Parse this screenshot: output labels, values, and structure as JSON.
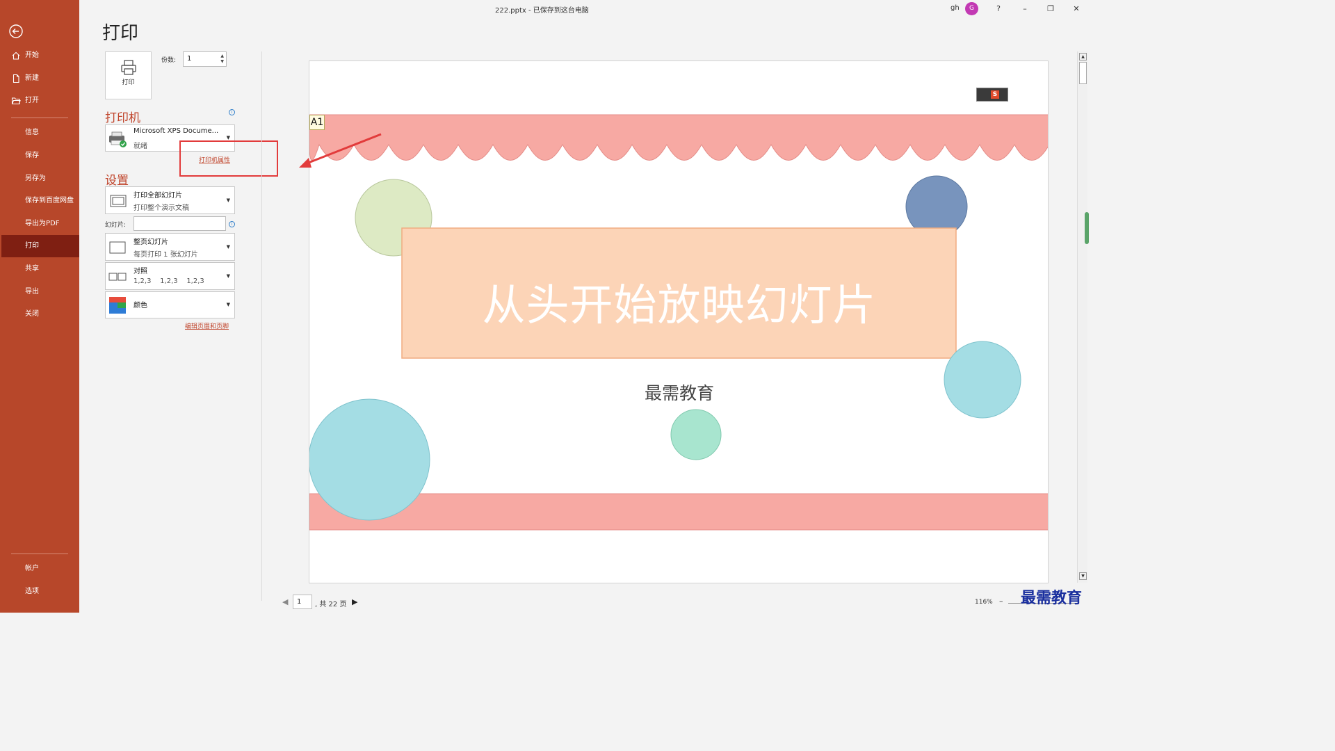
{
  "window": {
    "doc_title": "222.pptx  -  已保存到这台电脑",
    "user_name": "gh",
    "avatar_initial": "G",
    "help": "?",
    "minimize": "–",
    "restore": "❐",
    "close": "✕"
  },
  "sidebar": {
    "back_icon": "arrow-left-circle",
    "items": [
      {
        "label": "开始",
        "icon": "home-icon"
      },
      {
        "label": "新建",
        "icon": "new-doc-icon"
      },
      {
        "label": "打开",
        "icon": "folder-open-icon"
      },
      {
        "label": "信息"
      },
      {
        "label": "保存"
      },
      {
        "label": "另存为"
      },
      {
        "label": "保存到百度网盘"
      },
      {
        "label": "导出为PDF"
      },
      {
        "label": "打印",
        "active": true
      },
      {
        "label": "共享"
      },
      {
        "label": "导出"
      },
      {
        "label": "关闭"
      }
    ],
    "bottom_items": [
      {
        "label": "帐户"
      },
      {
        "label": "选项"
      }
    ],
    "colors": {
      "background": "#b7472a",
      "active": "#7f1f12"
    }
  },
  "print": {
    "page_title": "打印",
    "print_button_label": "打印",
    "copies_label": "份数:",
    "copies_value": "1",
    "printer_heading": "打印机",
    "printer_name": "Microsoft XPS Docume...",
    "printer_status": "就绪",
    "printer_properties_link": "打印机属性",
    "settings_heading": "设置",
    "range_main": "打印全部幻灯片",
    "range_sub": "打印整个演示文稿",
    "slides_label": "幻灯片:",
    "slides_value": "",
    "layout_main": "整页幻灯片",
    "layout_sub": "每页打印 1 张幻灯片",
    "collate_main": "对照",
    "collate_sub": "1,2,3    1,2,3    1,2,3",
    "color_main": "颜色",
    "edit_header_footer_link": "编辑页眉和页脚"
  },
  "preview": {
    "slide_title": "从头开始放映幻灯片",
    "slide_subtitle": "最需教育",
    "cell_tag": "A1",
    "ime_label": "S",
    "page_current": "1",
    "page_total": ", 共 22 页",
    "zoom": "116%",
    "zoom_minus": "–",
    "prev_arrow": "◀",
    "next_arrow": "▶",
    "colors": {
      "top_band": "#f7a9a3",
      "title_box": "#fcd4b7",
      "circle_green": "#ddeac4",
      "circle_blue": "#7894bd",
      "circle_cyan": "#a4dde4",
      "circle_mint": "#a8e5cf"
    }
  },
  "watermark": "最需教育"
}
